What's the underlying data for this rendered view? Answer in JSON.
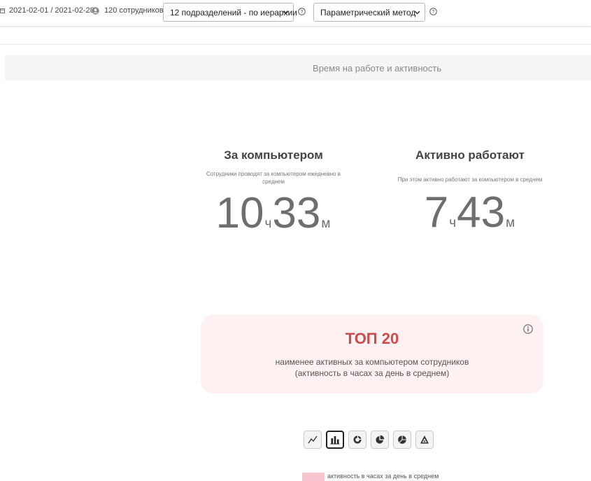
{
  "toolbar": {
    "date_range": "2021-02-01 / 2021-02-28",
    "employees": "120 сотрудников",
    "departments_select": "12 подразделений - по иерархии",
    "method_select": "Параметрический метод"
  },
  "section": {
    "title": "Время на работе и активность"
  },
  "metrics": [
    {
      "title": "За компьютером",
      "description": "Сотрудники проводят за компьютером ежедневно в среднем",
      "hours": "10",
      "hours_unit": "ч",
      "minutes": "33",
      "minutes_unit": "м"
    },
    {
      "title": "Активно работают",
      "description": "При этом активно работают за компьютером в среднем",
      "hours": "7",
      "hours_unit": "ч",
      "minutes": "43",
      "minutes_unit": "м"
    }
  ],
  "top_card": {
    "title": "ТОП 20",
    "subtitle_line1": "наименее активных за компьютером сотрудников",
    "subtitle_line2": "(активность в часах за день в среднем)"
  },
  "chart_buttons": [
    {
      "icon": "line-chart-icon",
      "active": false
    },
    {
      "icon": "bar-chart-icon",
      "active": true
    },
    {
      "icon": "donut-chart-icon",
      "active": false
    },
    {
      "icon": "pie-chart-icon",
      "active": false
    },
    {
      "icon": "polar-chart-icon",
      "active": false
    },
    {
      "icon": "radar-chart-icon",
      "active": false
    }
  ],
  "legend": {
    "label": "активность в часах за день в среднем",
    "color": "#f6c5cf"
  },
  "colors": {
    "accent_red": "#cc4b4b",
    "card_bg": "#fdf1f1"
  }
}
